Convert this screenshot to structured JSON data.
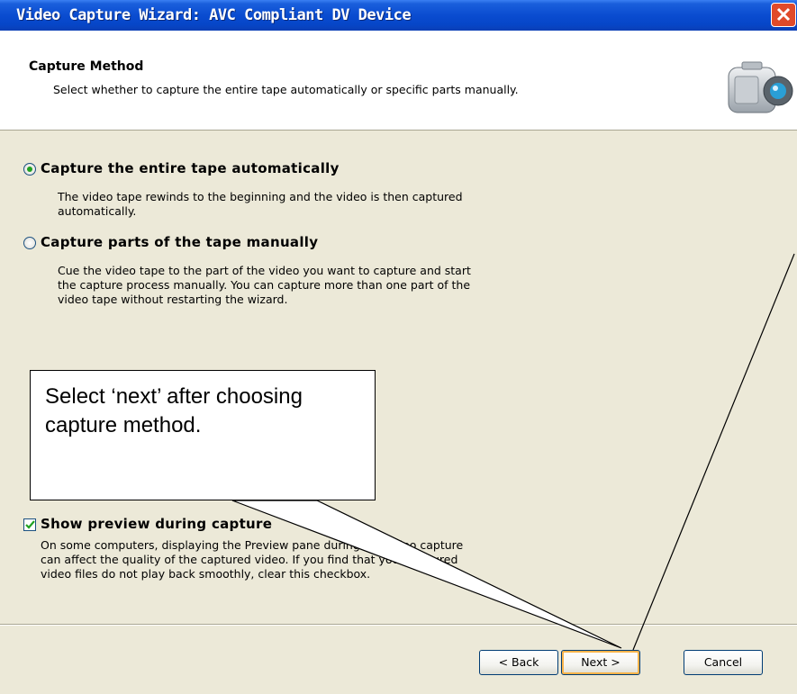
{
  "window": {
    "title": "Video Capture Wizard: AVC Compliant DV Device"
  },
  "header": {
    "title": "Capture Method",
    "subtitle": "Select whether to capture the entire tape automatically or specific parts manually."
  },
  "options": [
    {
      "label": "Capture the entire tape automatically",
      "selected": true,
      "description_lines": [
        "The video tape rewinds to the beginning and the video is then captured",
        "automatically."
      ]
    },
    {
      "label": "Capture parts of the tape manually",
      "selected": false,
      "description_lines": [
        "Cue the video tape to the part of the video you want to capture and start",
        "the capture process manually. You can capture more than one part of the",
        "video tape without restarting the wizard."
      ]
    }
  ],
  "preview": {
    "label": "Show preview during capture",
    "checked": true,
    "description_lines": [
      "On some computers, displaying the Preview pane during the video capture",
      "can affect the quality of the captured video. If you find that your captured",
      "video files do not play back smoothly, clear this checkbox."
    ]
  },
  "buttons": {
    "back": "< Back",
    "next": "Next >",
    "cancel": "Cancel"
  },
  "callout": {
    "text": "Select ‘next’ after choosing capture method."
  },
  "colors": {
    "titlebar": "#0a4cd0",
    "close": "#e04a2a",
    "radio_dot": "#21a121",
    "dialog": "#ece9d8"
  }
}
